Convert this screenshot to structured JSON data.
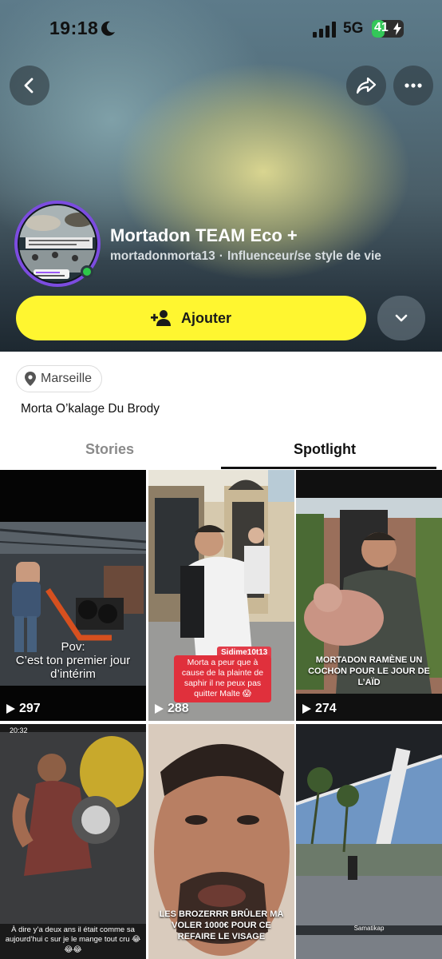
{
  "status_bar": {
    "time": "19:18",
    "network": "5G",
    "battery": "41",
    "battery_level": 0.41
  },
  "icons": {
    "back": "chevron-left-icon",
    "share": "share-arrow-icon",
    "more": "more-horizontal-icon",
    "add_friend": "person-add-icon",
    "dropdown": "chevron-down-icon",
    "location": "location-pin-icon",
    "play": "play-icon"
  },
  "colors": {
    "accent_yellow": "#FFF630",
    "avatar_ring": "#7C4CE0",
    "online": "#2EC84A"
  },
  "profile": {
    "display_name": "Mortadoո TEAM Eco +",
    "username": "mortadonmorta13",
    "separator": "·",
    "category": "Influenceur/se style de vie",
    "add_button_label": "Ajouter",
    "location": "Marseille",
    "bio": "Morta O’kalage Du Brody"
  },
  "tabs": {
    "stories": "Stories",
    "spotlight": "Spotlight",
    "active": "spotlight"
  },
  "spotlight": [
    {
      "views": "297",
      "caption_line1": "Pov:",
      "caption_line2": "C’est ton premier jour d’intérim"
    },
    {
      "views": "288",
      "tag": "Sidime10t13",
      "caption": "Morta a peur que à cause de la plainte de saphir il ne peux pas quitter Malte 😱"
    },
    {
      "views": "274",
      "caption": "MORTADON RAMÈNE UN COCHON POUR LE JOUR DE L’AÏD"
    },
    {
      "time": "20:32",
      "caption": "À dire y’a deux ans il était comme sa aujourd’hui c sur je le mange tout cru 😂😂😂"
    },
    {
      "caption": "LES BROZERRR BRÛLER MA VOLER 1000€ POUR CE REFAIRE LE VISAGE"
    },
    {
      "label": "Samatikap"
    }
  ]
}
